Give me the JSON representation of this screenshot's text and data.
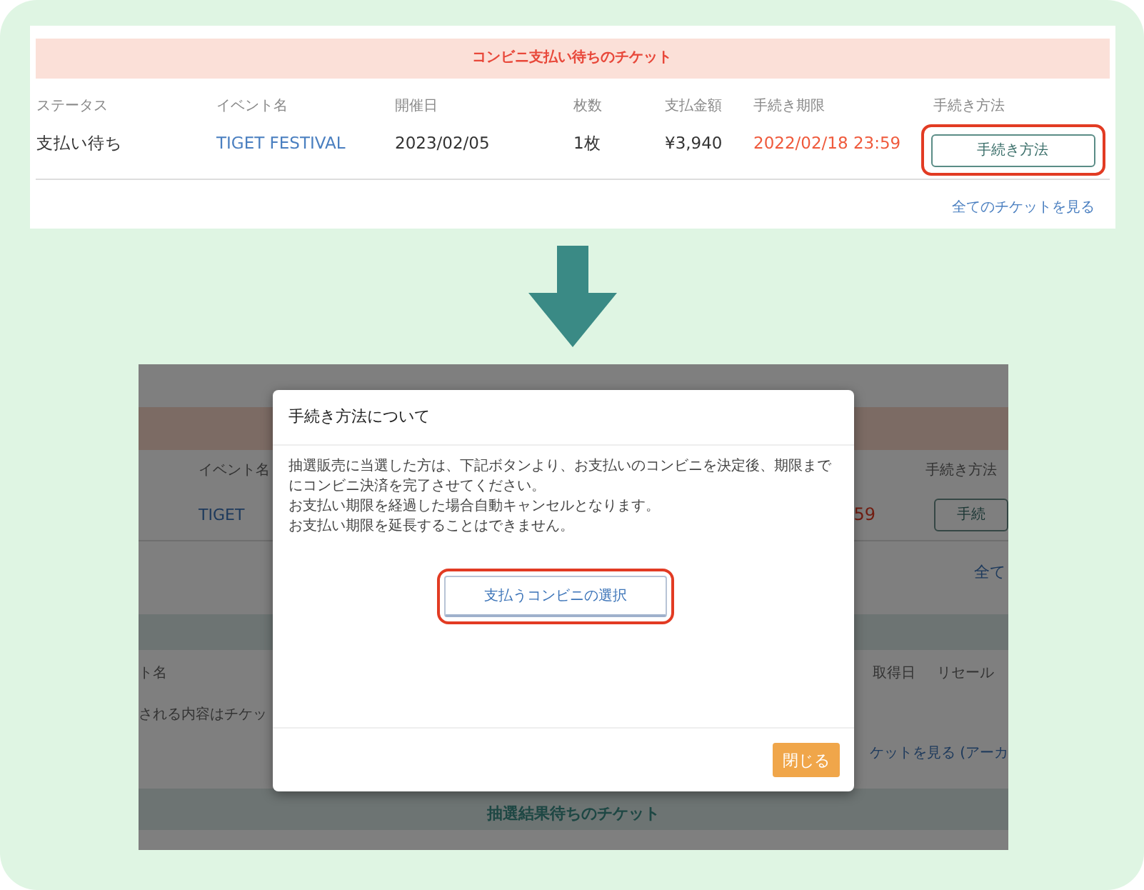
{
  "top_panel": {
    "section_title": "コンビニ支払い待ちのチケット",
    "columns": [
      "ステータス",
      "イベント名",
      "開催日",
      "枚数",
      "支払金額",
      "手続き期限",
      "手続き方法"
    ],
    "rows": [
      {
        "status": "支払い待ち",
        "event": "TIGET FESTIVAL",
        "date": "2023/02/05",
        "count": "1枚",
        "amount": "¥3,940",
        "deadline": "2022/02/18 23:59",
        "action": {
          "label": "手続き方法",
          "highlighted": true
        }
      }
    ],
    "all_link": "全てのチケットを見る"
  },
  "bottom_screenshot": {
    "background": {
      "header_event": "イベント名",
      "header_method": "手続き方法",
      "event": "TIGET",
      "deadline_tail": "59",
      "method_button": "手続",
      "all_link": "全て",
      "header_name": "ト名",
      "header_acquired": "取得日",
      "header_resale": "リセール",
      "note": "される内容はチケッ",
      "archive_link": "ケットを見る (アーカ",
      "section_title": "抽選結果待ちのチケット"
    },
    "modal": {
      "title": "手続き方法について",
      "body": [
        "抽選販売に当選した方は、下記ボタンより、お支払いのコンビニを決定後、期限までにコンビニ決済を完了させてください。",
        "お支払い期限を経過した場合自動キャンセルとなります。",
        "お支払い期限を延長することはできません。"
      ],
      "select_button": {
        "label": "支払うコンビニの選択",
        "highlighted": true
      },
      "close_button": "閉じる"
    }
  }
}
